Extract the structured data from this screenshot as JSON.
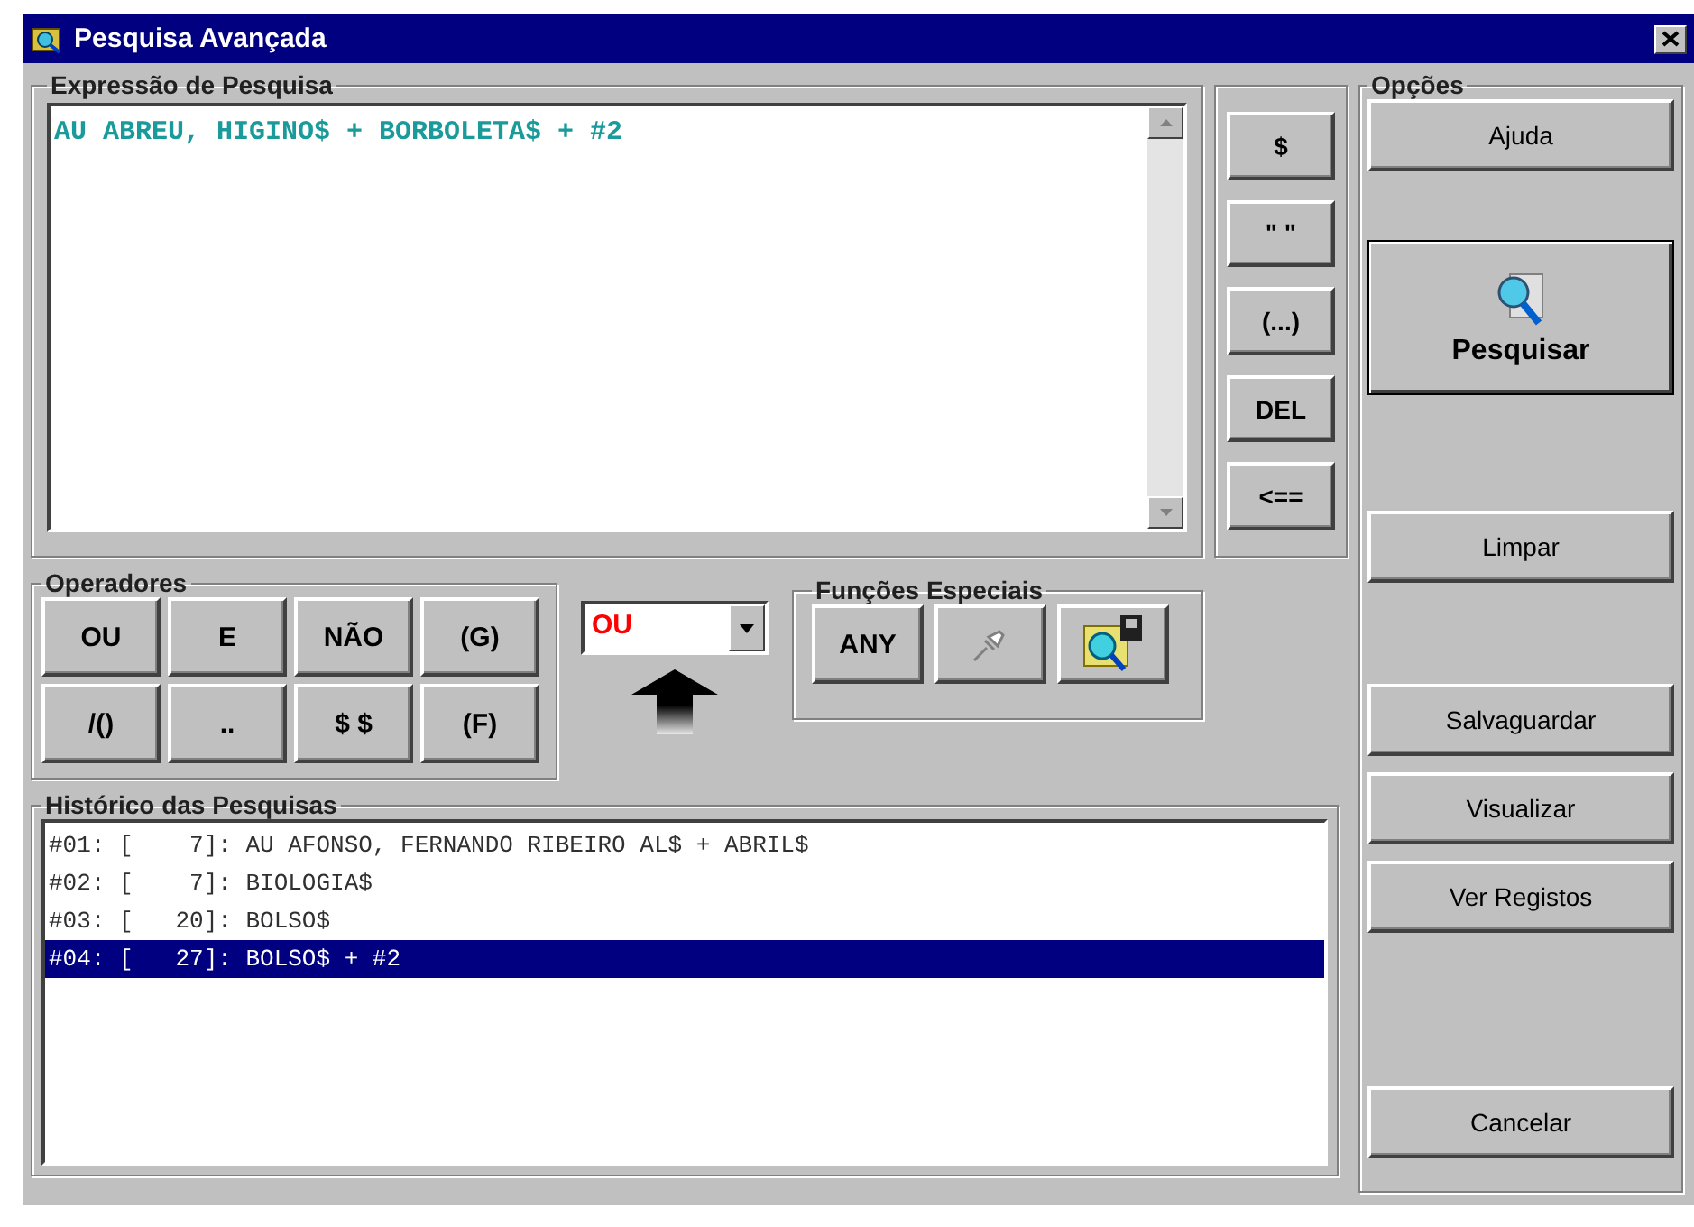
{
  "window": {
    "title": "Pesquisa Avançada"
  },
  "expression": {
    "label": "Expressão de Pesquisa",
    "value": "AU ABREU, HIGINO$ + BORBOLETA$ + #2"
  },
  "edit_buttons": [
    "$",
    "\" \"",
    "(...)",
    "DEL",
    "<=="
  ],
  "operators": {
    "label": "Operadores",
    "buttons": [
      "OU",
      "E",
      "NÃO",
      "(G)",
      "/()",
      "..",
      "$ $",
      "(F)"
    ]
  },
  "operator_select": {
    "value": "OU"
  },
  "special_functions": {
    "label": "Funções Especiais",
    "buttons": [
      {
        "kind": "text",
        "label": "ANY"
      },
      {
        "kind": "pin"
      },
      {
        "kind": "search-folder"
      }
    ]
  },
  "history": {
    "label": "Histórico das Pesquisas",
    "rows": [
      {
        "text": "#01: [    7]: AU AFONSO, FERNANDO RIBEIRO AL$ + ABRIL$",
        "selected": false
      },
      {
        "text": "#02: [    7]: BIOLOGIA$",
        "selected": false
      },
      {
        "text": "#03: [   20]: BOLSO$",
        "selected": false
      },
      {
        "text": "#04: [   27]: BOLSO$ + #2",
        "selected": true
      }
    ]
  },
  "options": {
    "label": "Opções",
    "buttons": [
      {
        "label": "Ajuda",
        "kind": "normal"
      },
      {
        "label": "Pesquisar",
        "kind": "main"
      },
      {
        "label": "Limpar",
        "kind": "normal"
      },
      {
        "label": "Salvaguardar",
        "kind": "normal"
      },
      {
        "label": "Visualizar",
        "kind": "normal"
      },
      {
        "label": "Ver Registos",
        "kind": "normal"
      },
      {
        "label": "Cancelar",
        "kind": "normal"
      }
    ]
  }
}
